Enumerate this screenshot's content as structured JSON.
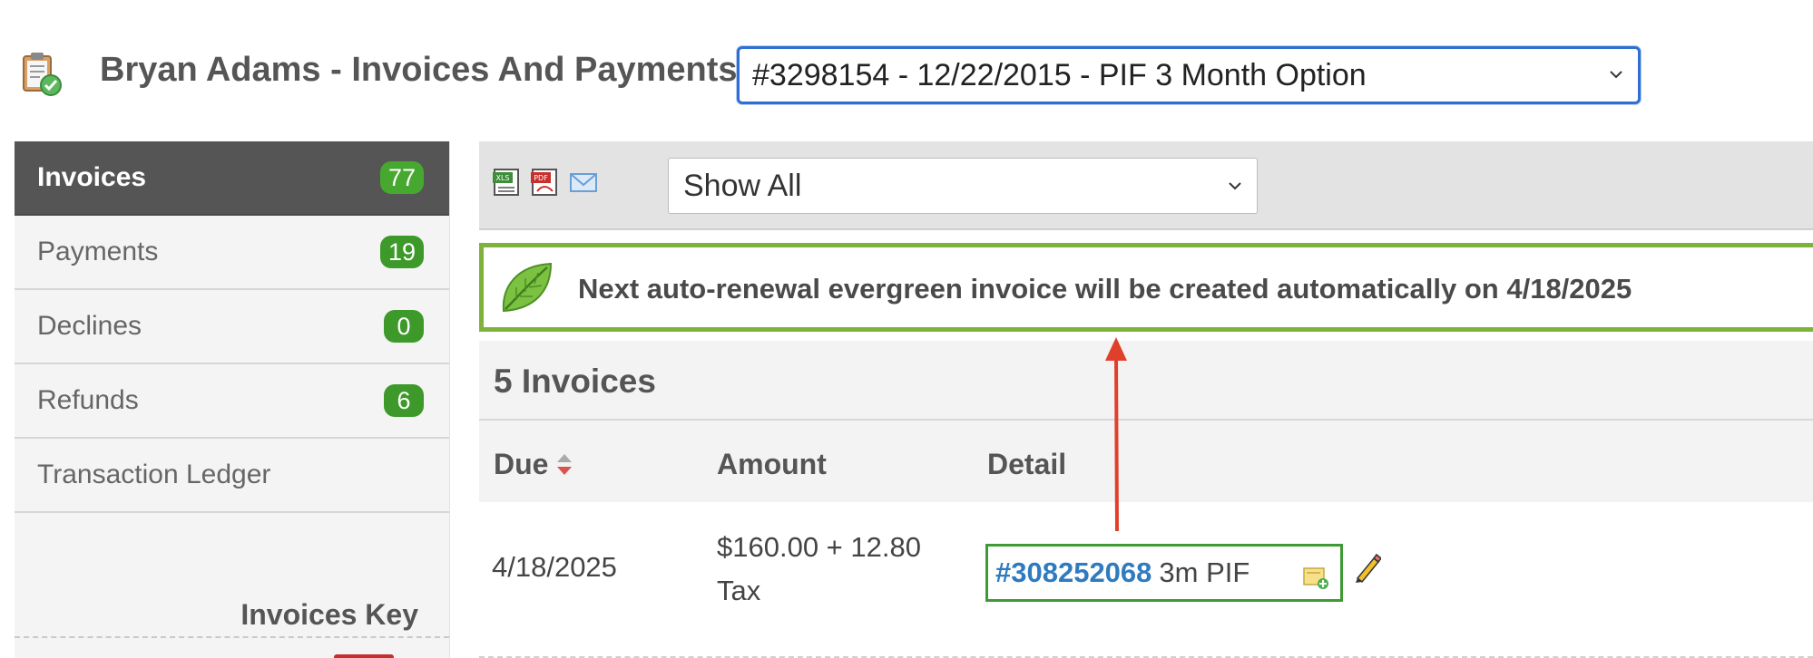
{
  "header": {
    "title": "Bryan Adams - Invoices And Payments",
    "contract_select": "#3298154 - 12/22/2015 - PIF 3 Month Option"
  },
  "sidebar": {
    "items": [
      {
        "label": "Invoices",
        "count": "77"
      },
      {
        "label": "Payments",
        "count": "19"
      },
      {
        "label": "Declines",
        "count": "0"
      },
      {
        "label": "Refunds",
        "count": "6"
      },
      {
        "label": "Transaction Ledger",
        "count": ""
      }
    ],
    "key_title": "Invoices Key"
  },
  "toolbar": {
    "icons": [
      "excel-export-icon",
      "pdf-export-icon",
      "email-icon"
    ],
    "filter_value": "Show All"
  },
  "notice": {
    "icon": "leaf-icon",
    "text": "Next auto-renewal evergreen invoice will be created automatically on 4/18/2025"
  },
  "invoices": {
    "title": "5 Invoices",
    "columns": [
      "Due",
      "Amount",
      "Detail"
    ],
    "rows": [
      {
        "due": "4/18/2025",
        "amount_line1": "$160.00 + 12.80",
        "amount_line2": "Tax",
        "invoice_number": "#308252068",
        "description": "3m PIF"
      }
    ]
  },
  "colors": {
    "accent_blue": "#2f6fd1",
    "badge_green": "#3d9a2a",
    "notice_border": "#7fb23a",
    "link": "#2f7bbf",
    "annotation_arrow": "#e0402b"
  }
}
